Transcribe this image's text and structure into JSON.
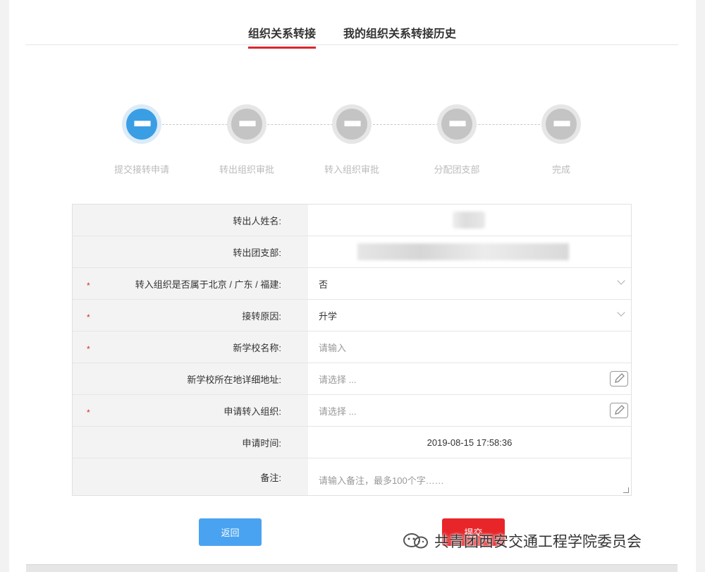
{
  "tabs": [
    {
      "label": "组织关系转接"
    },
    {
      "label": "我的组织关系转接历史"
    }
  ],
  "steps": [
    {
      "label": "提交接转申请",
      "icon": "dots-icon",
      "active": true
    },
    {
      "label": "转出组织审批",
      "icon": "dots-icon",
      "active": false
    },
    {
      "label": "转入组织审批",
      "icon": "dots-icon",
      "active": false
    },
    {
      "label": "分配团支部",
      "icon": "dots-icon",
      "active": false
    },
    {
      "label": "完成",
      "icon": "dots-icon",
      "active": false
    }
  ],
  "form": {
    "name_label": "转出人姓名:",
    "branch_label": "转出团支部:",
    "region_label": "转入组织是否属于北京 / 广东 / 福建:",
    "region_value": "否",
    "reason_label": "接转原因:",
    "reason_value": "升学",
    "school_label": "新学校名称:",
    "school_placeholder": "请输入",
    "address_label": "新学校所在地详细地址:",
    "address_placeholder": "请选择 ...",
    "org_label": "申请转入组织:",
    "org_placeholder": "请选择 ...",
    "time_label": "申请时间:",
    "time_value": "2019-08-15 17:58:36",
    "note_label": "备注:",
    "note_placeholder": "请输入备注，最多100个字……",
    "required_mark": "*"
  },
  "buttons": {
    "back": "返回",
    "submit": "提交"
  },
  "watermark": "共青团西安交通工程学院委员会",
  "colors": {
    "accent_red": "#d9282e",
    "step_active": "#3a9ee4",
    "back_button": "#4aa3f0",
    "submit_button": "#e8262a"
  }
}
